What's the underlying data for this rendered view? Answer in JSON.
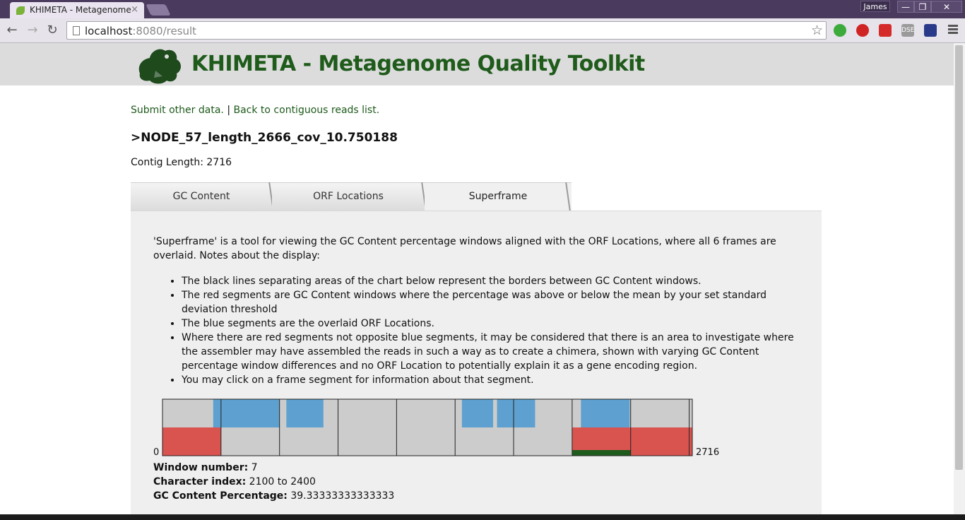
{
  "browser": {
    "tab_title": "KHIMETA - Metagenome",
    "tab_close": "×",
    "user_name": "James",
    "url_host": "localhost",
    "url_rest": ":8080/result",
    "window_buttons": [
      "—",
      "❐",
      "✕"
    ],
    "extensions": [
      {
        "name": "evernote-icon",
        "color": "#3cab3c",
        "label": ""
      },
      {
        "name": "adblock-icon",
        "color": "#d02424",
        "label": ""
      },
      {
        "name": "acrobat-icon",
        "color": "#d42a2a",
        "label": ""
      },
      {
        "name": "dse-icon",
        "color": "#9a9a9a",
        "label": "DSE"
      },
      {
        "name": "flag-icon",
        "color": "#2a3a8a",
        "label": ""
      }
    ]
  },
  "site": {
    "title": "KHIMETA - Metagenome Quality Toolkit"
  },
  "links": {
    "submit": "Submit other data.",
    "separator": "|",
    "back": "Back to contiguous reads list."
  },
  "contig": {
    "name": ">NODE_57_length_2666_cov_10.750188",
    "length_label": "Contig Length:",
    "length_value": "2716"
  },
  "tabs": [
    {
      "label": "GC Content",
      "active": false
    },
    {
      "label": "ORF Locations",
      "active": false
    },
    {
      "label": "Superframe",
      "active": true
    }
  ],
  "superframe": {
    "intro": "'Superframe' is a tool for viewing the GC Content percentage windows aligned with the ORF Locations, where all 6 frames are overlaid. Notes about the display:",
    "notes": [
      "The black lines separating areas of the chart below represent the borders between GC Content windows.",
      "The red segments are GC Content windows where the percentage was above or below the mean by your set standard deviation threshold",
      "The blue segments are the overlaid ORF Locations.",
      "Where there are red segments not opposite blue segments, it may be considered that there is an area to investigate where the assembler may have assembled the reads in such a way as to create a chimera, shown with varying GC Content percentage window differences and no ORF Location to potentially explain it as a gene encoding region.",
      "You may click on a frame segment for information about that segment."
    ]
  },
  "chart_data": {
    "type": "segment-track",
    "axis_start": "0",
    "axis_end": "2716",
    "length": 2716,
    "window_size": 300,
    "window_boundaries": [
      300,
      600,
      900,
      1200,
      1500,
      1800,
      2100,
      2400,
      2700
    ],
    "gc_windows": [
      {
        "window": 0,
        "start": 0,
        "end": 300,
        "flag": "deviant"
      },
      {
        "window": 1,
        "start": 300,
        "end": 600,
        "flag": "normal"
      },
      {
        "window": 2,
        "start": 600,
        "end": 900,
        "flag": "normal"
      },
      {
        "window": 3,
        "start": 900,
        "end": 1200,
        "flag": "normal"
      },
      {
        "window": 4,
        "start": 1200,
        "end": 1500,
        "flag": "normal"
      },
      {
        "window": 5,
        "start": 1500,
        "end": 1800,
        "flag": "normal"
      },
      {
        "window": 6,
        "start": 1800,
        "end": 2100,
        "flag": "normal"
      },
      {
        "window": 7,
        "start": 2100,
        "end": 2400,
        "flag": "selected"
      },
      {
        "window": 8,
        "start": 2400,
        "end": 2716,
        "flag": "deviant"
      }
    ],
    "orf_segments": [
      {
        "start": 260,
        "end": 600
      },
      {
        "start": 635,
        "end": 825
      },
      {
        "start": 1535,
        "end": 1695
      },
      {
        "start": 1715,
        "end": 1910
      },
      {
        "start": 2145,
        "end": 2395
      }
    ],
    "colors": {
      "background": "#cccccc",
      "gc_deviant": "#d9534f",
      "orf": "#5ea0cf",
      "selected": "#1e5c1e",
      "border": "#222222"
    }
  },
  "selection": {
    "window_label": "Window number:",
    "window_value": "7",
    "index_label": "Character index:",
    "index_value": "2100 to 2400",
    "gc_label": "GC Content Percentage:",
    "gc_value": "39.33333333333333"
  }
}
